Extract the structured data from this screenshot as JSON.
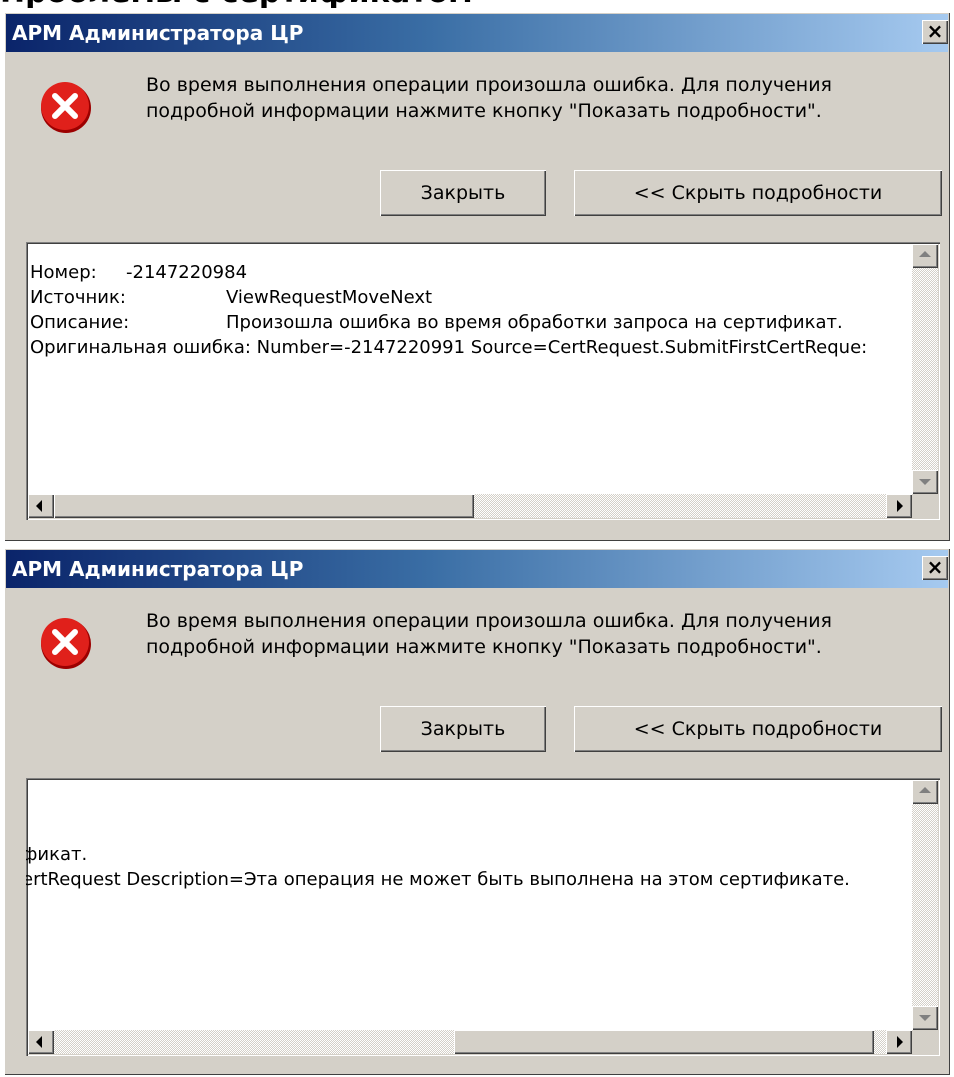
{
  "page": {
    "heading": "Проблемы с сертификатом"
  },
  "dialog": {
    "title": "АРМ Администратора ЦР",
    "close_glyph": "×",
    "icon": "error-icon",
    "message": "Во время выполнения операции произошла ошибка. Для получения подробной информации нажмите кнопку \"Показать подробности\".",
    "buttons": {
      "close_label": "Закрыть",
      "details_label": "<< Скрыть подробности"
    }
  },
  "details_view_1": {
    "rows": [
      {
        "key": "Номер:",
        "value": "-2147220984"
      },
      {
        "key": "Источник:",
        "value": "ViewRequestMoveNext"
      },
      {
        "key": "Описание:",
        "value": "Произошла ошибка во время обработки запроса на сертификат."
      }
    ],
    "original_error_line": "Оригинальная ошибка: Number=-2147220991 Source=CertRequest.SubmitFirstCertReque:"
  },
  "details_view_2": {
    "lines": [
      "фикат.",
      "ertRequest Description=Эта операция не может быть выполнена на этом сертификате."
    ]
  },
  "colors": {
    "title_start": "#0a246a",
    "title_end": "#a6caf0",
    "face": "#d4d0c8",
    "error_red": "#e0201b"
  }
}
